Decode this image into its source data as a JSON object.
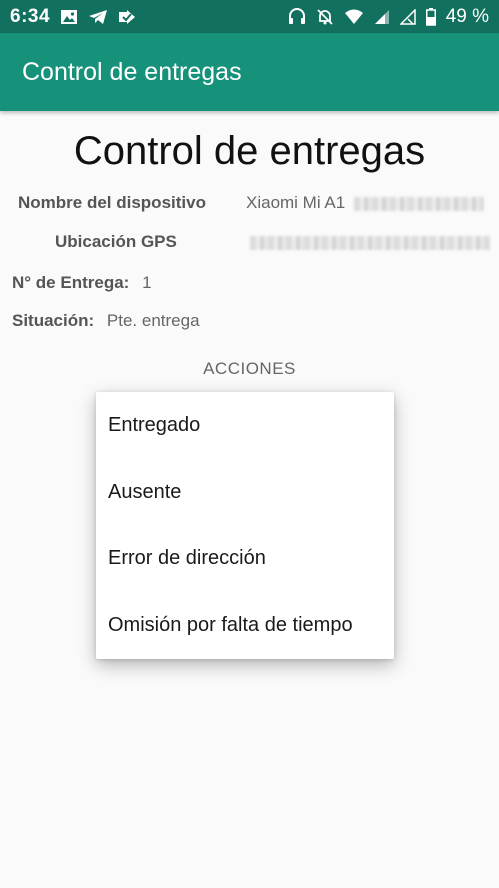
{
  "status_bar": {
    "time": "6:34",
    "battery": "49 %",
    "icons_left": [
      "image-icon",
      "telegram-icon",
      "notification-check-icon"
    ],
    "icons_right": [
      "headphones-icon",
      "bell-off-icon",
      "wifi-icon",
      "signal-icon",
      "no-signal-icon",
      "battery-icon"
    ]
  },
  "app_bar": {
    "title": "Control de entregas"
  },
  "main": {
    "title": "Control de entregas",
    "device_label": "Nombre del dispositivo",
    "device_value": "Xiaomi Mi A1",
    "gps_label": "Ubicación GPS",
    "delivery_label": "N° de Entrega:",
    "delivery_value": "1",
    "situation_label": "Situación:",
    "situation_value": "Pte. entrega",
    "actions_label": "ACCIONES"
  },
  "menu": {
    "items": [
      {
        "label": "Entregado"
      },
      {
        "label": "Ausente"
      },
      {
        "label": "Error de dirección"
      },
      {
        "label": "Omisión por falta de tiempo"
      }
    ]
  },
  "colors": {
    "status_bar": "#12705f",
    "app_bar": "#16917a",
    "background": "#fafafa"
  }
}
